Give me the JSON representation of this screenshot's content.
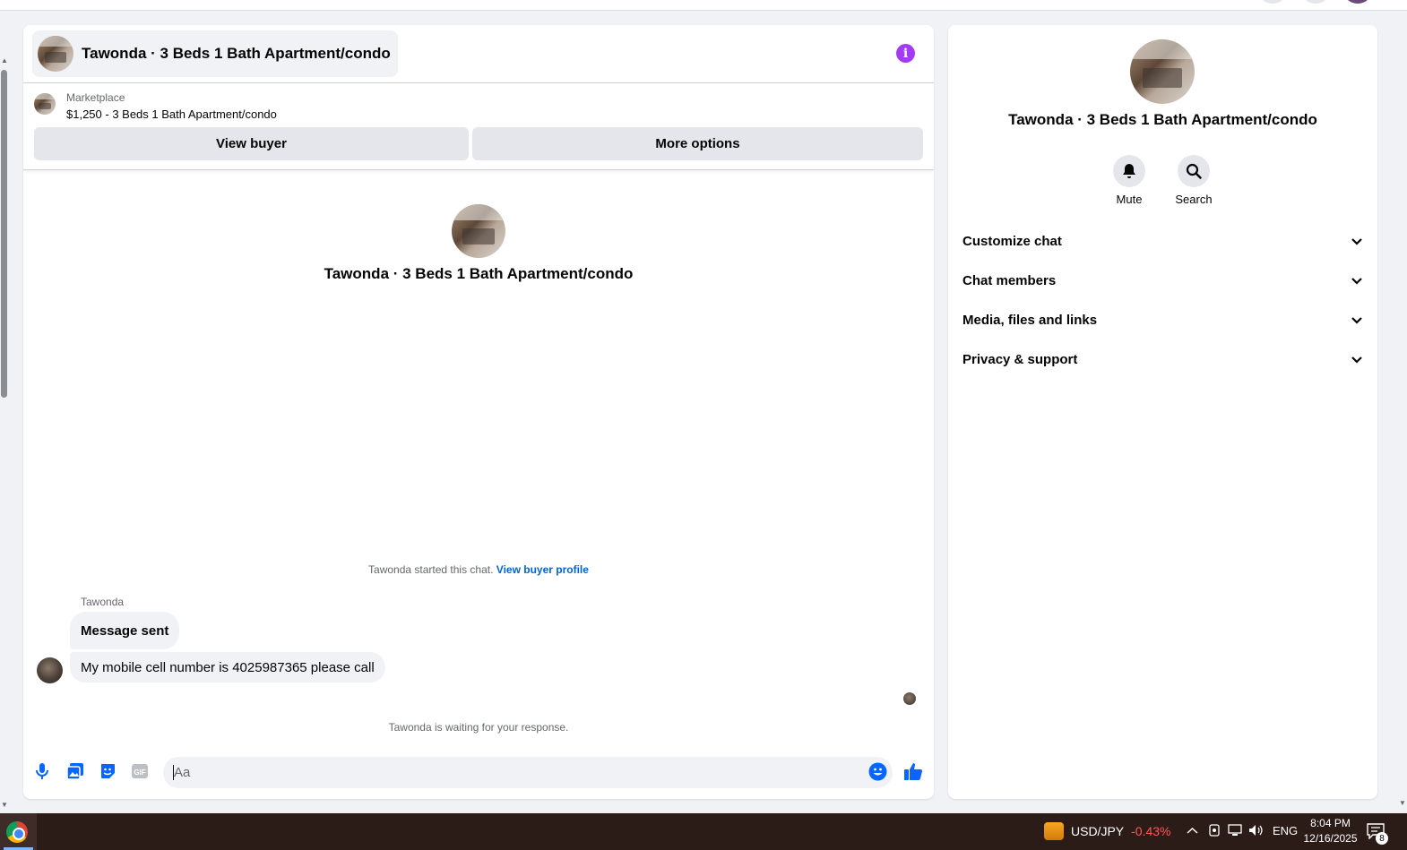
{
  "chat": {
    "title": "Tawonda · 3 Beds 1 Bath Apartment/condo",
    "listing": {
      "source": "Marketplace",
      "title": "$1,250 - 3 Beds 1 Bath Apartment/condo"
    },
    "buttons": {
      "view_buyer": "View buyer",
      "more_options": "More options"
    },
    "intro_title": "Tawonda · 3 Beds 1 Bath Apartment/condo",
    "started_text": "Tawonda started this chat.",
    "view_buyer_profile": "View buyer profile",
    "sender": "Tawonda",
    "messages": [
      "Message sent",
      "My mobile cell number is 4025987365 please call"
    ],
    "waiting_text": "Tawonda is waiting for your response.",
    "composer_placeholder": "Aa",
    "accent_color": "#0866ff",
    "info_icon_color": "#a33bf5"
  },
  "info_panel": {
    "title": "Tawonda · 3 Beds 1 Bath Apartment/condo",
    "actions": [
      {
        "label": "Mute",
        "icon": "bell-icon"
      },
      {
        "label": "Search",
        "icon": "search-icon"
      }
    ],
    "sections": [
      "Customize chat",
      "Chat members",
      "Media, files and links",
      "Privacy & support"
    ]
  },
  "taskbar": {
    "ticker_symbol": "USD/JPY",
    "ticker_change": "-0.43%",
    "language": "ENG",
    "time": "8:04 PM",
    "date": "12/16/2025",
    "notification_count": "8"
  }
}
